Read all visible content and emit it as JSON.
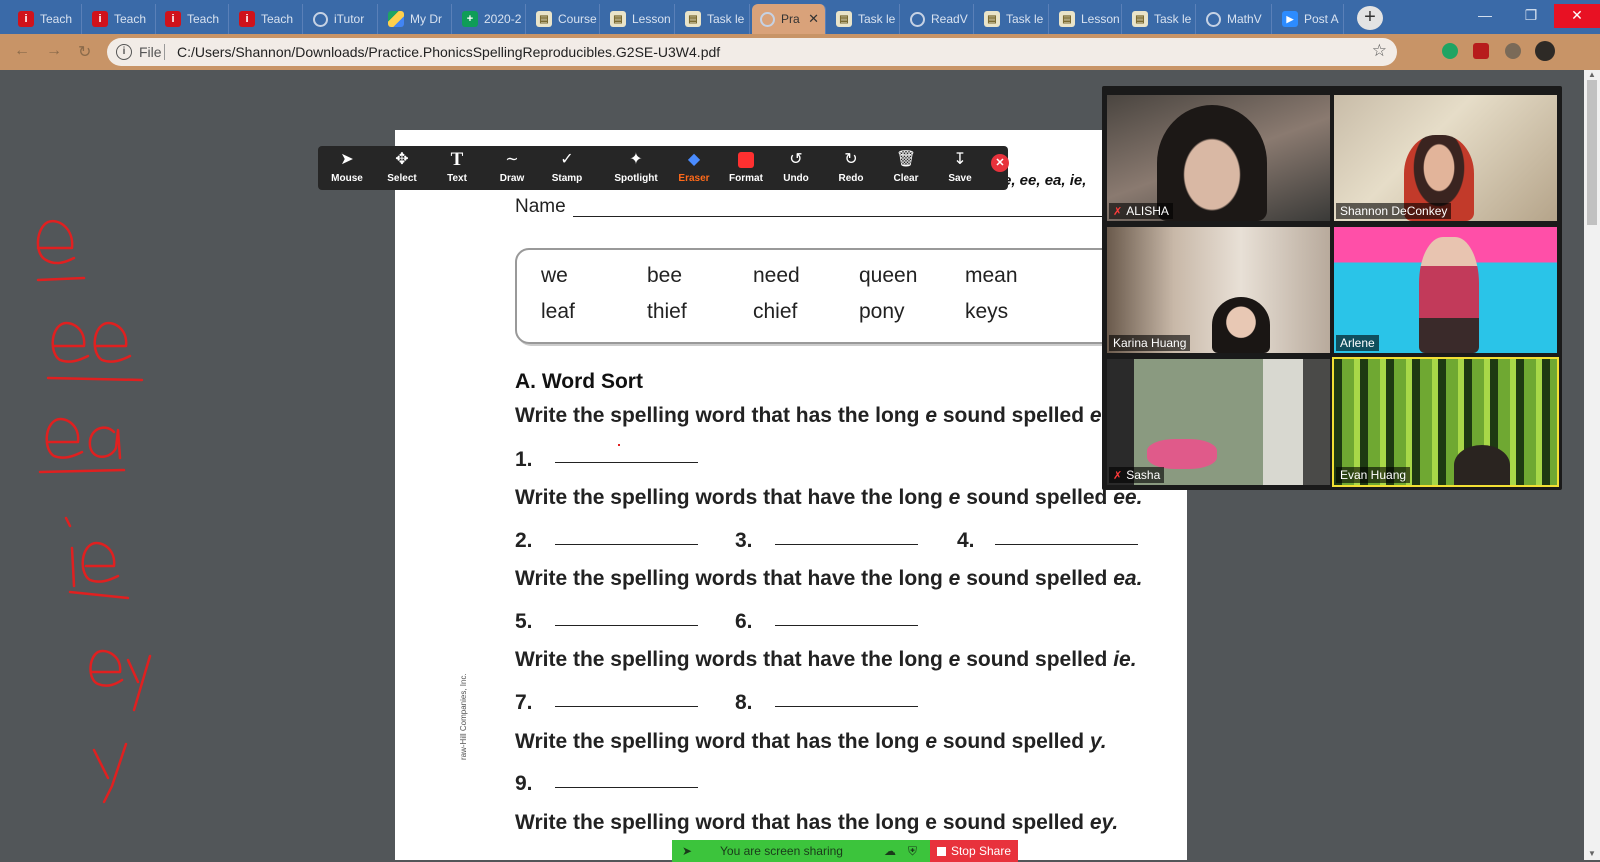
{
  "browser": {
    "tabs": [
      {
        "label": "Teach",
        "icon": "i"
      },
      {
        "label": "Teach",
        "icon": "i"
      },
      {
        "label": "Teach",
        "icon": "i"
      },
      {
        "label": "Teach",
        "icon": "i"
      },
      {
        "label": "iTutor",
        "icon": "globe"
      },
      {
        "label": "My Dr",
        "icon": "drive"
      },
      {
        "label": "2020-2",
        "icon": "sheet"
      },
      {
        "label": "Course",
        "icon": "doc"
      },
      {
        "label": "Lesson",
        "icon": "doc"
      },
      {
        "label": "Task le",
        "icon": "doc"
      },
      {
        "label": "Pra",
        "icon": "globe",
        "active": true
      },
      {
        "label": "Task le",
        "icon": "doc"
      },
      {
        "label": "ReadV",
        "icon": "globe"
      },
      {
        "label": "Task le",
        "icon": "doc"
      },
      {
        "label": "Lesson",
        "icon": "doc"
      },
      {
        "label": "Task le",
        "icon": "doc"
      },
      {
        "label": "MathV",
        "icon": "globe"
      },
      {
        "label": "Post A",
        "icon": "zoom"
      }
    ],
    "new_tab": "+",
    "file_label": "File",
    "url": "C:/Users/Shannon/Downloads/Practice.PhonicsSpellingReproducibles.G2SE-U3W4.pdf"
  },
  "annotation_toolbar": {
    "tools": [
      {
        "label": "Mouse",
        "icon": "cursor-icon"
      },
      {
        "label": "Select",
        "icon": "move-icon"
      },
      {
        "label": "Text",
        "icon": "text-icon"
      },
      {
        "label": "Draw",
        "icon": "draw-icon"
      },
      {
        "label": "Stamp",
        "icon": "check-icon"
      },
      {
        "label": "Spotlight",
        "icon": "spotlight-icon"
      },
      {
        "label": "Eraser",
        "icon": "eraser-icon",
        "active": true
      },
      {
        "label": "Format",
        "icon": "format-icon"
      },
      {
        "label": "Undo",
        "icon": "undo-icon"
      },
      {
        "label": "Redo",
        "icon": "redo-icon"
      },
      {
        "label": "Clear",
        "icon": "trash-icon"
      },
      {
        "label": "Save",
        "icon": "save-icon"
      }
    ]
  },
  "worksheet": {
    "header_italic": "e, ee, ea, ie,",
    "name_label": "Name",
    "word_bank": [
      [
        "we",
        "bee",
        "need",
        "queen",
        "mean"
      ],
      [
        "leaf",
        "thief",
        "chief",
        "pony",
        "keys"
      ]
    ],
    "section_title": "A. Word Sort",
    "instructions": [
      {
        "pre": "Write the spelling word that has the long ",
        "em": "e",
        "post": " sound spelled ",
        "tail": "e"
      },
      {
        "pre": "Write the spelling words that have the long ",
        "em": "e",
        "post": " sound spelled ",
        "tail": "ee."
      },
      {
        "pre": "Write the spelling words that have the long ",
        "em": "e",
        "post": " sound spelled ",
        "tail": "ea."
      },
      {
        "pre": "Write the spelling words that have the long ",
        "em": "e",
        "post": " sound spelled ",
        "tail": "ie."
      },
      {
        "pre": "Write the spelling word that has the long ",
        "em": "e",
        "post": " sound spelled ",
        "tail": "y."
      },
      {
        "pre": "Write the spellin",
        "em": "g word that has the long e sound",
        "post": " spelled ",
        "tail": "ey."
      }
    ],
    "numbers": [
      "1.",
      "2.",
      "3.",
      "4.",
      "5.",
      "6.",
      "7.",
      "8.",
      "9."
    ],
    "side_copyright": "raw-Hill Companies, Inc."
  },
  "participants": [
    {
      "name": "ALISHA",
      "muted": true
    },
    {
      "name": "Shannon DeConkey",
      "muted": false
    },
    {
      "name": "Karina Huang",
      "muted": false
    },
    {
      "name": "Arlene",
      "muted": false
    },
    {
      "name": "Sasha",
      "muted": true
    },
    {
      "name": "Evan Huang",
      "muted": false
    }
  ],
  "screen_share": {
    "status": "You are screen sharing",
    "stop_label": "Stop Share"
  },
  "handwriting": [
    "e",
    "ee",
    "ea",
    "ie",
    "ey",
    "y"
  ],
  "colors": {
    "annotation_red": "#e02020",
    "tab_strip": "#3a6aa8",
    "share_green": "#3cc43c",
    "stop_red": "#e8323c",
    "eraser_active": "#ff6a1a"
  }
}
